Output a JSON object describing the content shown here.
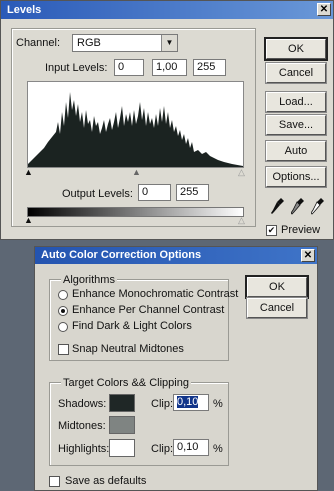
{
  "levels": {
    "title": "Levels",
    "channel_label": "Channel:",
    "channel_value": "RGB",
    "input_levels_label": "Input Levels:",
    "input_values": [
      "0",
      "1,00",
      "255"
    ],
    "output_levels_label": "Output Levels:",
    "output_values": [
      "0",
      "255"
    ],
    "buttons": {
      "ok": "OK",
      "cancel": "Cancel",
      "load": "Load...",
      "save": "Save...",
      "auto": "Auto",
      "options": "Options..."
    },
    "preview_label": "Preview",
    "preview_checked": true
  },
  "auto_color": {
    "title": "Auto Color Correction Options",
    "algorithms_label": "Algorithms",
    "algorithms": [
      {
        "label": "Enhance Monochromatic Contrast",
        "selected": false
      },
      {
        "label": "Enhance Per Channel Contrast",
        "selected": true
      },
      {
        "label": "Find Dark & Light Colors",
        "selected": false
      }
    ],
    "snap_label": "Snap Neutral Midtones",
    "snap_checked": false,
    "target_label": "Target Colors && Clipping",
    "shadows_label": "Shadows:",
    "midtones_label": "Midtones:",
    "highlights_label": "Highlights:",
    "clip_label": "Clip:",
    "shadows_clip": "0,10",
    "highlights_clip": "0,10",
    "percent": "%",
    "save_defaults_label": "Save as defaults",
    "ok": "OK",
    "cancel": "Cancel",
    "colors": {
      "shadows": "#1f2726",
      "midtones": "#7f8482",
      "highlights": "#ffffff"
    }
  },
  "icons": [
    "close-icon",
    "dropdown-arrow-icon",
    "black-eyedropper-icon",
    "gray-eyedropper-icon",
    "white-eyedropper-icon",
    "slider-triangle-icon"
  ]
}
